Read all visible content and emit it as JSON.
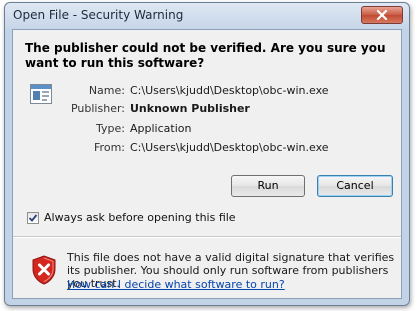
{
  "window": {
    "title": "Open File - Security Warning"
  },
  "dialog": {
    "heading": "The publisher could not be verified.  Are you sure you want to run this software?",
    "app_icon": "application-window-icon",
    "fields": [
      {
        "label": "Name:",
        "value": "C:\\Users\\kjudd\\Desktop\\obc-win.exe",
        "bold": false
      },
      {
        "label": "Publisher:",
        "value": "Unknown Publisher",
        "bold": true
      },
      {
        "label": "Type:",
        "value": "Application",
        "bold": false
      },
      {
        "label": "From:",
        "value": "C:\\Users\\kjudd\\Desktop\\obc-win.exe",
        "bold": false
      }
    ],
    "run_label": "Run",
    "cancel_label": "Cancel",
    "checkbox": {
      "label": "Always ask before opening this file",
      "checked": true
    },
    "warning": {
      "icon": "shield-error-icon",
      "text": "This file does not have a valid digital signature that verifies its publisher.  You should only run software from publishers you trust.",
      "link": "How can I decide what software to run?"
    }
  },
  "colors": {
    "link": "#0645ad",
    "shield_red": "#d4261f",
    "close_red": "#c85c44"
  }
}
